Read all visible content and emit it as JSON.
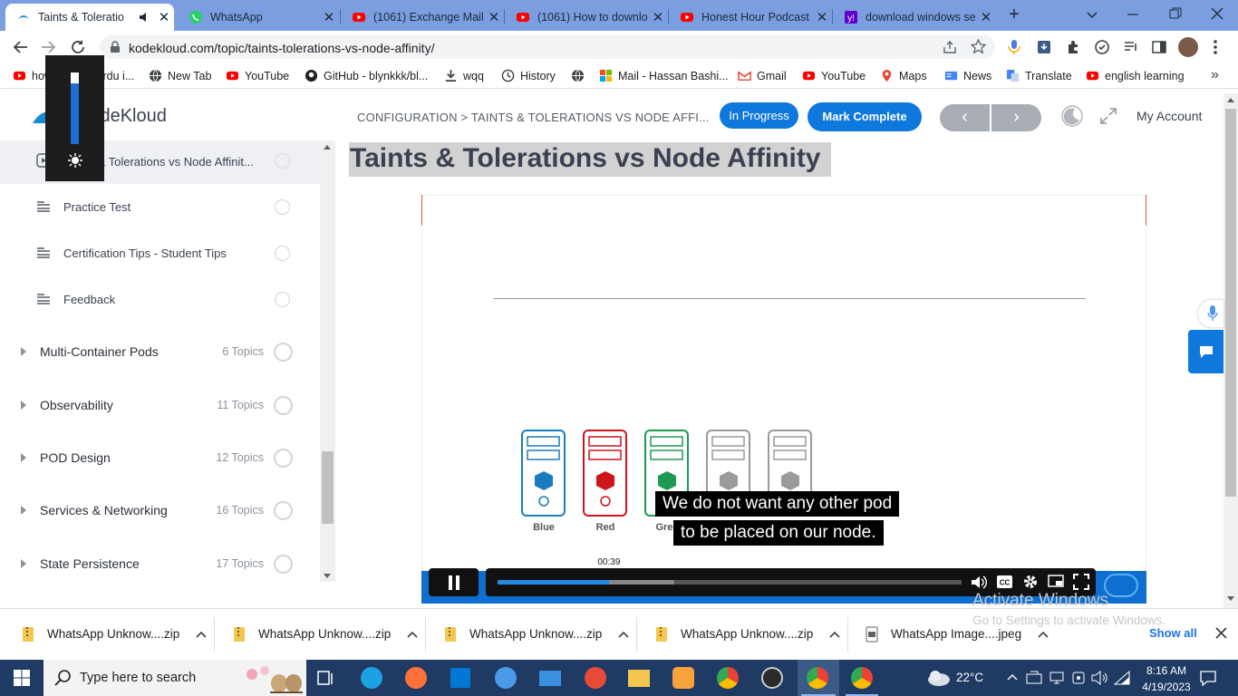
{
  "browser": {
    "tabs": [
      {
        "title": "Taints & Toleratio",
        "icon": "kodekloud-icon",
        "active": true,
        "audio": true
      },
      {
        "title": "WhatsApp",
        "icon": "whatsapp-icon"
      },
      {
        "title": "(1061) Exchange Mail",
        "icon": "youtube-icon"
      },
      {
        "title": "(1061) How to downlo",
        "icon": "youtube-icon"
      },
      {
        "title": "Honest Hour Podcast",
        "icon": "youtube-icon"
      },
      {
        "title": "download windows se",
        "icon": "yahoo-icon"
      }
    ],
    "new_tab_label": "+",
    "url": "kodekloud.com/topic/taints-tolerations-vs-node-affinity/",
    "bookmarks": [
      "how to learn urdu i...",
      "New Tab",
      "YouTube",
      "GitHub - blynkkk/bl...",
      "wqq",
      "History",
      "",
      "Mail - Hassan Bashi...",
      "Gmail",
      "YouTube",
      "Maps",
      "News",
      "Translate",
      "english learning"
    ],
    "bookmarks_more": "»"
  },
  "header": {
    "logo_text": "KodeKloud",
    "breadcrumb": "CONFIGURATION > TAINTS & TOLERATIONS VS NODE AFFI...",
    "status_badge": "In Progress",
    "mark_complete": "Mark Complete",
    "prev": "‹",
    "next": "›",
    "account": "My Account"
  },
  "sidebar": {
    "current_lesson": "Taints & Tolerations vs Node Affinit...",
    "lessons": [
      "Practice Test",
      "Certification Tips - Student Tips",
      "Feedback"
    ],
    "sections": [
      {
        "title": "Multi-Container Pods",
        "count": "6 Topics"
      },
      {
        "title": "Observability",
        "count": "11 Topics"
      },
      {
        "title": "POD Design",
        "count": "12 Topics"
      },
      {
        "title": "Services & Networking",
        "count": "16 Topics"
      },
      {
        "title": "State Persistence",
        "count": "17 Topics"
      }
    ]
  },
  "lesson_title": "Taints & Tolerations vs Node Affinity",
  "video": {
    "nodes": [
      {
        "label": "Blue",
        "color": "#1b7bc0"
      },
      {
        "label": "Red",
        "color": "#d0141b"
      },
      {
        "label": "Gree",
        "color": "#1e9b52"
      },
      {
        "label": "",
        "color": "#9a9a9a"
      },
      {
        "label": "",
        "color": "#9a9a9a"
      }
    ],
    "subtitle_line1": "We do not want any other pod",
    "subtitle_line2": "to be placed on our node.",
    "time": "00:39",
    "progress": 0.24,
    "buffered": 0.38
  },
  "watermark": {
    "line1": "Activate Windows",
    "line2": "Go to Settings to activate Windows."
  },
  "downloads": {
    "items": [
      "WhatsApp Unknow....zip",
      "WhatsApp Unknow....zip",
      "WhatsApp Unknow....zip",
      "WhatsApp Unknow....zip",
      "WhatsApp Image....jpeg"
    ],
    "show_all": "Show all"
  },
  "taskbar": {
    "search_placeholder": "Type here to search",
    "weather": "22°C",
    "time": "8:16 AM",
    "date": "4/19/2023"
  }
}
